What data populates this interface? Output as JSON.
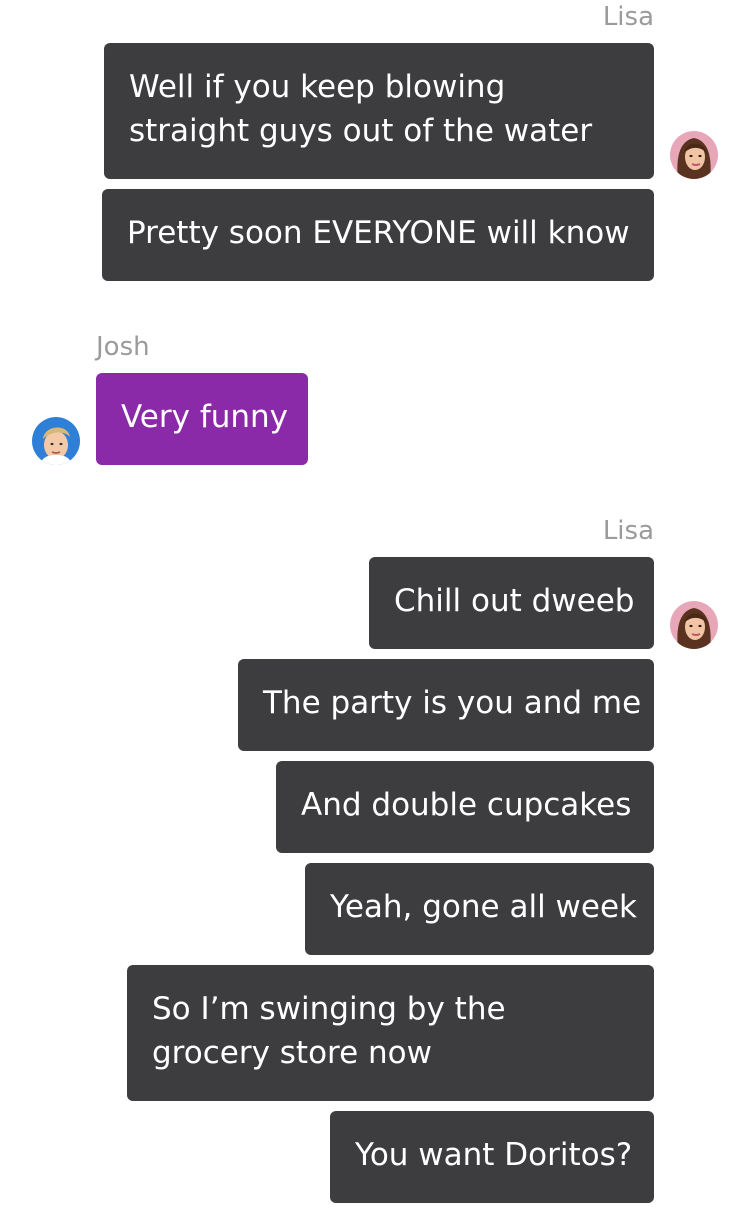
{
  "colors": {
    "outgoing_bubble": "#3d3d3f",
    "incoming_bubble": "#8b2aa8",
    "sender_name": "#9b9b9b"
  },
  "groups": [
    {
      "sender": "Lisa",
      "avatar": "lisa-avatar-icon",
      "messages": [
        "Well if you keep blowing straight guys out of the water",
        "Pretty soon EVERYONE will know"
      ]
    },
    {
      "sender": "Josh",
      "avatar": "josh-avatar-icon",
      "messages": [
        "Very funny"
      ]
    },
    {
      "sender": "Lisa",
      "avatar": "lisa-avatar-icon",
      "messages": [
        "Chill out dweeb",
        "The party is you and me",
        "And double cupcakes",
        "Yeah, gone all week",
        "So I’m swinging by the grocery store now",
        "You want Doritos?"
      ]
    }
  ]
}
